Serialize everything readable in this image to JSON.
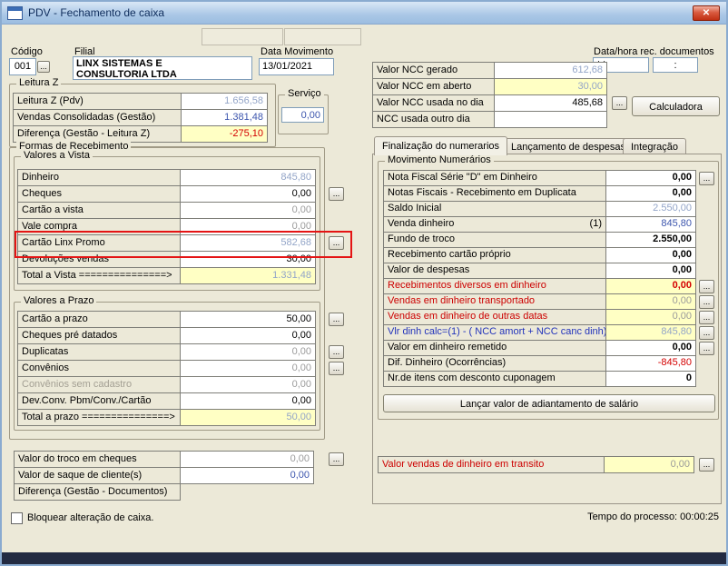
{
  "window": {
    "title": "PDV - Fechamento de caixa",
    "close_glyph": "✕"
  },
  "header": {
    "codigo_label": "Código",
    "codigo_value": "001",
    "codigo_more": "...",
    "filial_label": "Filial",
    "filial_value_line1": "LINX SISTEMAS E",
    "filial_value_line2": "CONSULTORIA LTDA",
    "data_movimento_label": "Data Movimento",
    "data_movimento_value": "13/01/2021",
    "doc_datetime_label": "Data/hora rec. documentos",
    "doc_date_value": "/ /",
    "doc_time_value": ":"
  },
  "ncc": {
    "rows": [
      {
        "label": "Valor NCC gerado",
        "value": "612,68"
      },
      {
        "label": "Valor NCC em aberto",
        "value": "30,00"
      },
      {
        "label": "Valor NCC usada no dia",
        "value": "485,68",
        "more": "..."
      },
      {
        "label": "NCC usada outro dia",
        "value": ""
      }
    ],
    "calculadora_button": "Calculadora"
  },
  "leitura_z": {
    "title": "Leitura Z",
    "rows": [
      {
        "label": "Leitura Z (Pdv)",
        "value": "1.656,58"
      },
      {
        "label": "Vendas Consolidadas (Gestão)",
        "value": "1.381,48"
      },
      {
        "label": "Diferença (Gestão - Leitura Z)",
        "value": "-275,10"
      }
    ],
    "servico_label": "Serviço",
    "servico_value": "0,00"
  },
  "formas": {
    "title": "Formas de Recebimento",
    "vista": {
      "title": "Valores a Vista",
      "rows": [
        {
          "label": "Dinheiro",
          "value": "845,80"
        },
        {
          "label": "Cheques",
          "value": "0,00",
          "more": "..."
        },
        {
          "label": "Cartão a vista",
          "value": "0,00"
        },
        {
          "label": "Vale compra",
          "value": "0,00"
        },
        {
          "label": "Cartão Linx Promo",
          "value": "582,68",
          "more": "..."
        },
        {
          "label": "Devoluções vendas",
          "value": "30,00"
        },
        {
          "label": "Total a Vista ===============>",
          "value": "1.331,48"
        }
      ]
    },
    "prazo": {
      "title": "Valores a Prazo",
      "rows": [
        {
          "label": "Cartão a prazo",
          "value": "50,00",
          "more": "..."
        },
        {
          "label": "Cheques pré datados",
          "value": "0,00"
        },
        {
          "label": "Duplicatas",
          "value": "0,00",
          "more": "..."
        },
        {
          "label": "Convênios",
          "value": "0,00",
          "more": "..."
        },
        {
          "label": "Convênios sem cadastro",
          "value": "0,00"
        },
        {
          "label": "Dev.Conv. Pbm/Conv./Cartão",
          "value": "0,00"
        },
        {
          "label": "Total a prazo ===============>",
          "value": "50,00"
        }
      ]
    },
    "troco": {
      "rows": [
        {
          "label": "Valor do troco em cheques",
          "value": "0,00",
          "more": "..."
        },
        {
          "label": "Valor de saque de cliente(s)",
          "value": "0,00"
        },
        {
          "label": "Diferença (Gestão - Documentos)",
          "value": ""
        }
      ]
    }
  },
  "tabs": [
    {
      "label": "Finalização do numerarios"
    },
    {
      "label": "Lançamento de despesas"
    },
    {
      "label": "Integração"
    }
  ],
  "movimento": {
    "title": "Movimento Numerários",
    "rows": [
      {
        "label": "Nota Fiscal Série \"D\" em Dinheiro",
        "value": "0,00",
        "more": "..."
      },
      {
        "label": "Notas Fiscais - Recebimento em Duplicata",
        "value": "0,00"
      },
      {
        "label": "Saldo Inicial",
        "value": "2.550,00"
      },
      {
        "label": "Venda dinheiro",
        "note": "(1)",
        "value": "845,80"
      },
      {
        "label": "Fundo de troco",
        "value": "2.550,00"
      },
      {
        "label": "Recebimento cartão próprio",
        "value": "0,00"
      },
      {
        "label": "Valor de despesas",
        "value": "0,00"
      },
      {
        "label": "Recebimentos diversos em dinheiro",
        "value": "0,00",
        "more": "..."
      },
      {
        "label": "Vendas em dinheiro transportado",
        "value": "0,00",
        "more": "..."
      },
      {
        "label": "Vendas em dinheiro de outras datas",
        "value": "0,00",
        "more": "..."
      },
      {
        "label": "Vlr dinh calc=(1) -  ( NCC amort + NCC canc dinh)",
        "value": "845,80",
        "more": "..."
      },
      {
        "label": "Valor em dinheiro remetido",
        "value": "0,00",
        "more": "..."
      },
      {
        "label": "Dif. Dinheiro (Ocorrências)",
        "value": "-845,80"
      },
      {
        "label": "Nr.de itens com desconto cuponagem",
        "value": "0"
      }
    ],
    "adiantamento_button": "Lançar valor de adiantamento de salário",
    "transito_label": "Valor vendas de dinheiro em transito",
    "transito_value": "0,00",
    "transito_more": "..."
  },
  "footer": {
    "bloquear_label": "Bloquear alteração de caixa.",
    "tempo_processo": "Tempo do processo: 00:00:25"
  },
  "colors": {
    "window_bg": "#ece9d8",
    "titlebar_top": "#d9e7f6",
    "titlebar_bottom": "#9cbde0",
    "highlight_yellow": "#ffffc4",
    "value_blue": "#3c55ad",
    "value_disabled_blue": "#93a5c8",
    "value_gray": "#9b9b9b",
    "alert_red": "#d40000",
    "annotation_red": "#e41414"
  }
}
